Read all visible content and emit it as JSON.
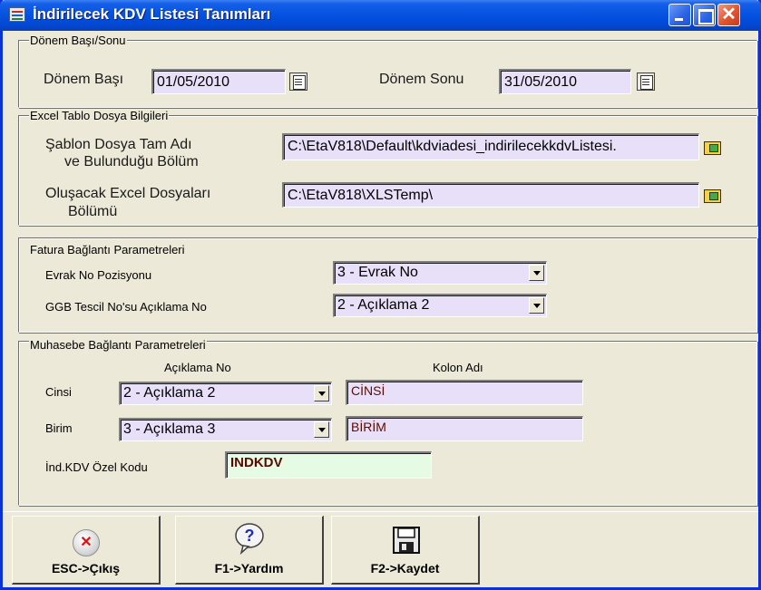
{
  "window": {
    "title": "İndirilecek KDV Listesi Tanımları"
  },
  "period": {
    "group_title": "Dönem Başı/Sonu",
    "start_label": "Dönem Başı",
    "start_value": "01/05/2010",
    "end_label": "Dönem Sonu",
    "end_value": "31/05/2010"
  },
  "excel": {
    "group_title": "Excel Tablo Dosya Bilgileri",
    "template_label_line1": "Şablon Dosya Tam Adı",
    "template_label_line2": "ve Bulunduğu Bölüm",
    "template_value": "C:\\EtaV818\\Default\\kdviadesi_indirilecekkdvListesi.",
    "output_label_line1": "Oluşacak Excel Dosyaları",
    "output_label_line2": "Bölümü",
    "output_value": "C:\\EtaV818\\XLSTemp\\"
  },
  "invoice": {
    "group_title": "Fatura Bağlantı Parametreleri",
    "doc_no_label": "Evrak No Pozisyonu",
    "doc_no_value": "3 - Evrak No",
    "ggb_label": "GGB Tescil No'su Açıklama No",
    "ggb_value": "2 - Açıklama 2"
  },
  "accounting": {
    "group_title": "Muhasebe Bağlantı Parametreleri",
    "col_desc_header": "Açıklama No",
    "col_name_header": "Kolon Adı",
    "type_label": "Cinsi",
    "type_combo": "2 - Açıklama 2",
    "type_column": "CİNSİ",
    "unit_label": "Birim",
    "unit_combo": "3 - Açıklama 3",
    "unit_column": "BİRİM",
    "special_code_label": "İnd.KDV Özel Kodu",
    "special_code_value": "INDKDV"
  },
  "toolbar": {
    "exit_label": "ESC->Çıkış",
    "help_label": "F1->Yardım",
    "save_label": "F2->Kaydet"
  },
  "colors": {
    "titlebar": "#0553E0",
    "field_bg": "#E8E0F8",
    "code_field_bg": "#E6FBE4",
    "window_bg": "#ECE9D8"
  }
}
